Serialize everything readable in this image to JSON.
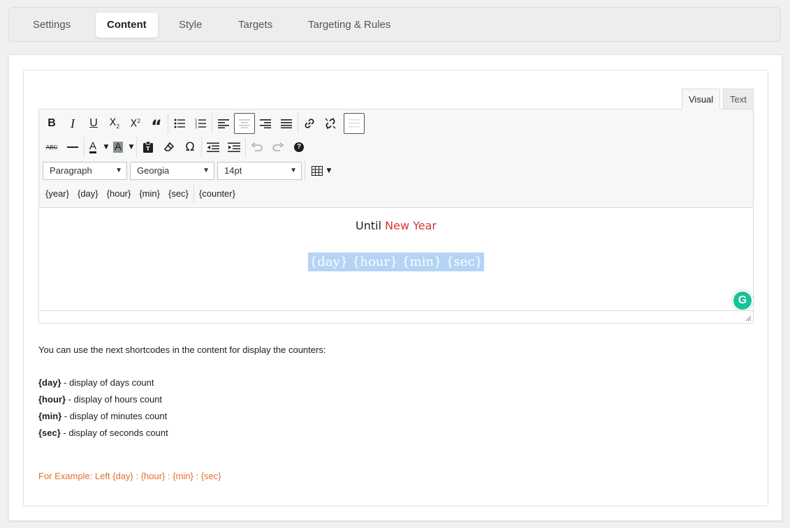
{
  "tabs": [
    {
      "label": "Settings",
      "active": false
    },
    {
      "label": "Content",
      "active": true
    },
    {
      "label": "Style",
      "active": false
    },
    {
      "label": "Targets",
      "active": false
    },
    {
      "label": "Targeting & Rules",
      "active": false
    }
  ],
  "editor": {
    "mode_tabs": {
      "visual": "Visual",
      "text": "Text"
    },
    "toolbar": {
      "row1_icons": [
        "bold-icon",
        "italic-icon",
        "underline-icon",
        "subscript-icon",
        "superscript-icon",
        "blockquote-icon",
        "bullet-list-icon",
        "numbered-list-icon",
        "align-left-icon",
        "align-center-icon",
        "align-right-icon",
        "align-justify-icon",
        "link-icon",
        "unlink-icon",
        "toolbar-toggle-icon"
      ],
      "row2_icons": [
        "strikethrough-icon",
        "horizontal-line-icon",
        "text-color-icon",
        "background-color-icon",
        "paste-text-icon",
        "clear-formatting-icon",
        "special-character-icon",
        "outdent-icon",
        "indent-icon",
        "undo-icon",
        "redo-icon",
        "help-icon"
      ],
      "format_select": "Paragraph",
      "font_select": "Georgia",
      "size_select": "14pt",
      "shortcode_buttons": [
        "{year}",
        "{day}",
        "{hour}",
        "{min}",
        "{sec}",
        "{counter}"
      ]
    },
    "content": {
      "line1_prefix": "Until",
      "line1_highlight": "New Year",
      "line1_highlight_color": "#d63638",
      "line2_selected": "{day} {hour} {min} {sec}"
    },
    "grammarly_letter": "G"
  },
  "help": {
    "intro": "You can use the next shortcodes in the content for display the counters:",
    "items": [
      {
        "code": "{day}",
        "desc": " - display of days count"
      },
      {
        "code": "{hour}",
        "desc": " - display of hours count"
      },
      {
        "code": "{min}",
        "desc": " - display of minutes count"
      },
      {
        "code": "{sec}",
        "desc": " - display of seconds count"
      }
    ],
    "example": "For Example: Left {day} : {hour} : {min} : {sec}",
    "example_color": "#e26f2b"
  }
}
